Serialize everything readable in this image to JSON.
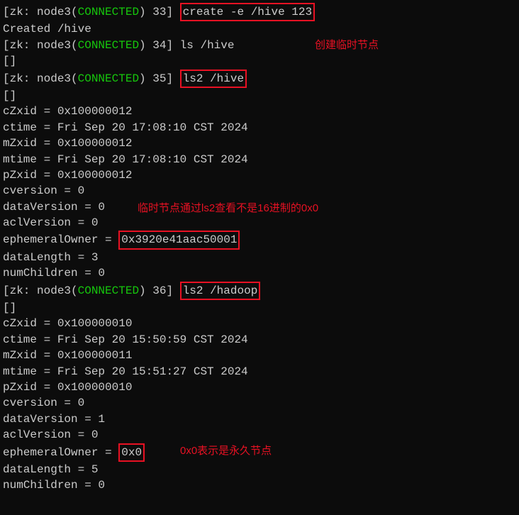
{
  "prompt": {
    "prefix": "[zk: node3(",
    "status": "CONNECTED",
    "suffix": ") "
  },
  "lines": {
    "l1_num": "33]",
    "l1_cmd": "create -e /hive 123",
    "l2": "Created /hive",
    "l3_num": "34]",
    "l3_cmd": " ls /hive",
    "l3_annotation": "创建临时节点",
    "l4": "[]",
    "l5_num": "35]",
    "l5_cmd": "ls2 /hive",
    "l6": "[]",
    "l7": "cZxid = 0x100000012",
    "l8": "ctime = Fri Sep 20 17:08:10 CST 2024",
    "l9": "mZxid = 0x100000012",
    "l10": "mtime = Fri Sep 20 17:08:10 CST 2024",
    "l11": "pZxid = 0x100000012",
    "l12": "cversion = 0",
    "l13": "dataVersion = 0",
    "l13_annotation": "临时节点通过ls2查看不是16进制的0x0",
    "l14": "aclVersion = 0",
    "l15_prefix": "ephemeralOwner = ",
    "l15_val": "0x3920e41aac50001",
    "l16": "dataLength = 3",
    "l17": "numChildren = 0",
    "l18_num": "36]",
    "l18_cmd": "ls2 /hadoop",
    "l19": "[]",
    "l20": "cZxid = 0x100000010",
    "l21": "ctime = Fri Sep 20 15:50:59 CST 2024",
    "l22": "mZxid = 0x100000011",
    "l23": "mtime = Fri Sep 20 15:51:27 CST 2024",
    "l24": "pZxid = 0x100000010",
    "l25": "cversion = 0",
    "l26": "dataVersion = 1",
    "l27": "aclVersion = 0",
    "l28_prefix": "ephemeralOwner = ",
    "l28_val": "0x0",
    "l28_annotation": "0x0表示是永久节点",
    "l29": "dataLength = 5",
    "l30": "numChildren = 0"
  }
}
